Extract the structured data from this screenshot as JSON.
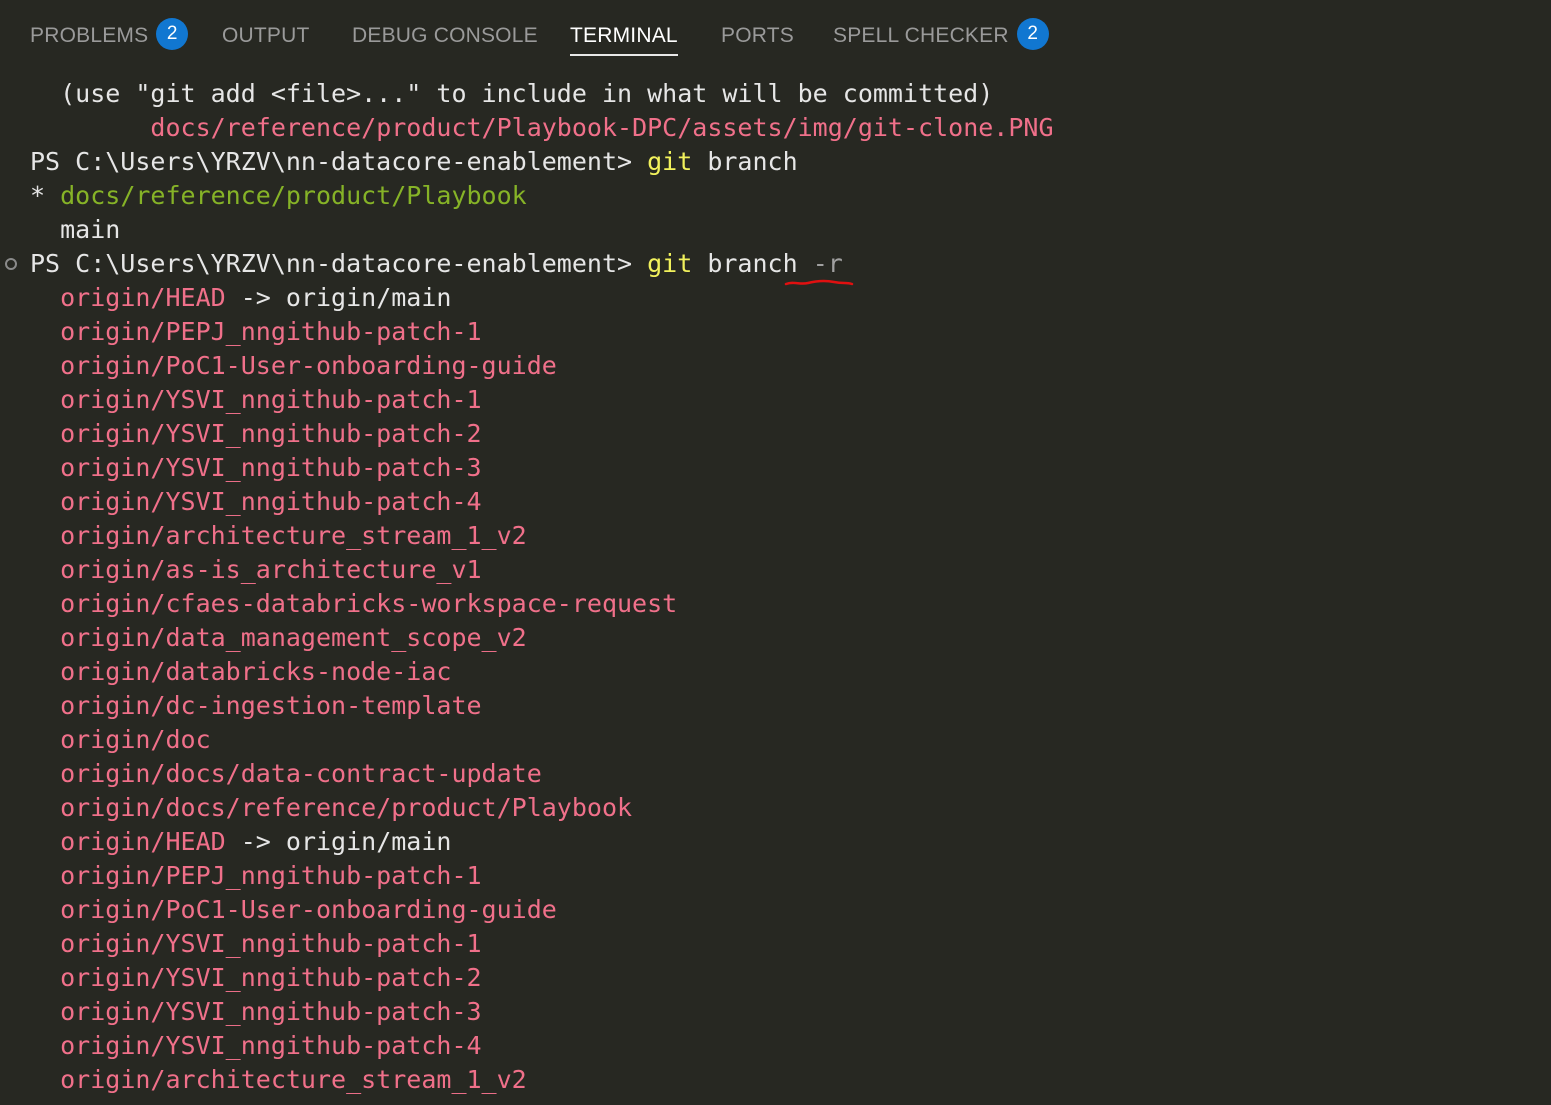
{
  "tabs": [
    {
      "label": "PROBLEMS",
      "badge": "2",
      "active": false
    },
    {
      "label": "OUTPUT",
      "active": false
    },
    {
      "label": "DEBUG CONSOLE",
      "active": false
    },
    {
      "label": "TERMINAL",
      "active": true
    },
    {
      "label": "PORTS",
      "active": false
    },
    {
      "label": "SPELL CHECKER",
      "badge": "2",
      "active": false
    }
  ],
  "colors": {
    "background": "#272822",
    "default_text": "#e6e6e6",
    "branch_red": "#f0708a",
    "current_branch_green": "#86b327",
    "command_yellow": "#f1f15c",
    "badge_blue": "#1177d1",
    "annotation_red": "#e01010"
  },
  "terminal": {
    "lines": [
      {
        "indent": "  ",
        "segments": [
          {
            "text": "(use \"git add <file>...\" to include in what will be committed)",
            "color": "default"
          }
        ]
      },
      {
        "indent": "        ",
        "segments": [
          {
            "text": "docs/reference/product/Playbook-DPC/assets/img/git-clone.PNG",
            "color": "red"
          }
        ]
      },
      {
        "indent": "",
        "segments": [
          {
            "text": "PS C:\\Users\\YRZV\\nn-datacore-enablement> ",
            "color": "default"
          },
          {
            "text": "git",
            "color": "yellow"
          },
          {
            "text": " branch",
            "color": "default"
          }
        ]
      },
      {
        "indent": "",
        "segments": [
          {
            "text": "* ",
            "color": "default"
          },
          {
            "text": "docs/reference/product/Playbook",
            "color": "green"
          }
        ]
      },
      {
        "indent": "  ",
        "segments": [
          {
            "text": "main",
            "color": "default"
          }
        ]
      },
      {
        "indent": "",
        "circle": true,
        "segments": [
          {
            "text": "PS C:\\Users\\YRZV\\nn-datacore-enablement> ",
            "color": "default"
          },
          {
            "text": "git",
            "color": "yellow"
          },
          {
            "text": " branch ",
            "color": "default"
          },
          {
            "text": "-r",
            "color": "gray"
          }
        ]
      },
      {
        "indent": "  ",
        "segments": [
          {
            "text": "origin/HEAD",
            "color": "red"
          },
          {
            "text": " -> origin/main",
            "color": "default"
          }
        ]
      },
      {
        "indent": "  ",
        "segments": [
          {
            "text": "origin/PEPJ_nngithub-patch-1",
            "color": "red"
          }
        ]
      },
      {
        "indent": "  ",
        "segments": [
          {
            "text": "origin/PoC1-User-onboarding-guide",
            "color": "red"
          }
        ]
      },
      {
        "indent": "  ",
        "segments": [
          {
            "text": "origin/YSVI_nngithub-patch-1",
            "color": "red"
          }
        ]
      },
      {
        "indent": "  ",
        "segments": [
          {
            "text": "origin/YSVI_nngithub-patch-2",
            "color": "red"
          }
        ]
      },
      {
        "indent": "  ",
        "segments": [
          {
            "text": "origin/YSVI_nngithub-patch-3",
            "color": "red"
          }
        ]
      },
      {
        "indent": "  ",
        "segments": [
          {
            "text": "origin/YSVI_nngithub-patch-4",
            "color": "red"
          }
        ]
      },
      {
        "indent": "  ",
        "segments": [
          {
            "text": "origin/architecture_stream_1_v2",
            "color": "red"
          }
        ]
      },
      {
        "indent": "  ",
        "segments": [
          {
            "text": "origin/as-is_architecture_v1",
            "color": "red"
          }
        ]
      },
      {
        "indent": "  ",
        "segments": [
          {
            "text": "origin/cfaes-databricks-workspace-request",
            "color": "red"
          }
        ]
      },
      {
        "indent": "  ",
        "segments": [
          {
            "text": "origin/data_management_scope_v2",
            "color": "red"
          }
        ]
      },
      {
        "indent": "  ",
        "segments": [
          {
            "text": "origin/databricks-node-iac",
            "color": "red"
          }
        ]
      },
      {
        "indent": "  ",
        "segments": [
          {
            "text": "origin/dc-ingestion-template",
            "color": "red"
          }
        ]
      },
      {
        "indent": "  ",
        "segments": [
          {
            "text": "origin/doc",
            "color": "red"
          }
        ]
      },
      {
        "indent": "  ",
        "segments": [
          {
            "text": "origin/docs/data-contract-update",
            "color": "red"
          }
        ]
      },
      {
        "indent": "  ",
        "segments": [
          {
            "text": "origin/docs/reference/product/Playbook",
            "color": "red"
          }
        ]
      },
      {
        "indent": "  ",
        "segments": [
          {
            "text": "origin/HEAD",
            "color": "red"
          },
          {
            "text": " -> origin/main",
            "color": "default"
          }
        ]
      },
      {
        "indent": "  ",
        "segments": [
          {
            "text": "origin/PEPJ_nngithub-patch-1",
            "color": "red"
          }
        ]
      },
      {
        "indent": "  ",
        "segments": [
          {
            "text": "origin/PoC1-User-onboarding-guide",
            "color": "red"
          }
        ]
      },
      {
        "indent": "  ",
        "segments": [
          {
            "text": "origin/YSVI_nngithub-patch-1",
            "color": "red"
          }
        ]
      },
      {
        "indent": "  ",
        "segments": [
          {
            "text": "origin/YSVI_nngithub-patch-2",
            "color": "red"
          }
        ]
      },
      {
        "indent": "  ",
        "segments": [
          {
            "text": "origin/YSVI_nngithub-patch-3",
            "color": "red"
          }
        ]
      },
      {
        "indent": "  ",
        "segments": [
          {
            "text": "origin/YSVI_nngithub-patch-4",
            "color": "red"
          }
        ]
      },
      {
        "indent": "  ",
        "segments": [
          {
            "text": "origin/architecture_stream_1_v2",
            "color": "red"
          }
        ]
      }
    ]
  }
}
